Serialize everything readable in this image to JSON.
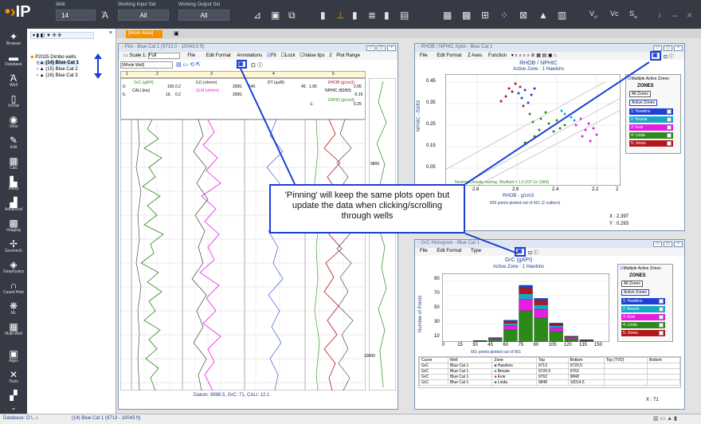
{
  "app": {
    "logo": "IP"
  },
  "toolbar": {
    "well_label": "Well",
    "well_value": "14",
    "input_set_label": "Working Input Set",
    "input_set_value": "All",
    "output_set_label": "Working Output Set",
    "output_set_value": "All",
    "right_labels": [
      "V",
      "Vc",
      "S"
    ]
  },
  "sidebar": {
    "items": [
      "Browser",
      "Database",
      "Well",
      "In/Out",
      "View",
      "Edit",
      "Calc",
      "Interp",
      "Advanced",
      "Imaging",
      "Geomech",
      "Geophysics",
      "Cased Hole",
      "ML",
      "Multi-Well",
      "Apps",
      "Tools"
    ]
  },
  "tree": {
    "root": "P2025 Dimbo wells",
    "items": [
      "(14) Blue Cat 1",
      "(15) Blue Cat 2",
      "(16) Blue Cat 3"
    ]
  },
  "workspace": {
    "tab": "[Work Area]"
  },
  "plot_window": {
    "title": "Plot - Blue Cat 1 (9713.0 - 10043.0 ft)",
    "scale_label": "Scale 1:",
    "scale_value": "Full",
    "menu": [
      "File",
      "Edit Format",
      "Annotations",
      "Fit",
      "Lock",
      "Value tips",
      "2",
      "Plot Range"
    ],
    "range": "[Whole Well]",
    "tracks": [
      "1",
      "2",
      "3",
      "4",
      "5"
    ],
    "curves": {
      "t2": [
        "GrC (gAPI)",
        "CALI (ins)"
      ],
      "t3": [
        "ILD (ohmm)",
        "SLM (ohmm)"
      ],
      "t4": [
        "DT (us/ft)"
      ],
      "t5": [
        "RHOB (g/cm3)",
        "NPHIC (ft3/ft3)",
        "DRHO (g/cm3)"
      ]
    },
    "scale_values": [
      "0.",
      "150.",
      "0.2",
      "2000.",
      "140.",
      "40.",
      "1.95",
      "2.95",
      "0.45",
      "-0.15",
      "-1.",
      "0.25",
      "6.",
      "16.",
      "0.2",
      "2000."
    ],
    "depth_marks": [
      "9800",
      "10000"
    ],
    "footer": "Datum: 9898.5,   GrC: 71,   CALI: 12.1"
  },
  "xplot_window": {
    "title": "RHOB / NPHIC Xplot - Blue Cat 1",
    "menu": [
      "File",
      "Edit Format",
      "Z Axes",
      "Function"
    ],
    "chart_title": "RHOB / NPHIC",
    "subtitle": "Active Zone : 1  Hawkins",
    "xlabel": "RHOB - g/cm3",
    "ylabel": "NPHIC - ft3/ft3",
    "yticks": [
      "0.45",
      "0.35",
      "0.25",
      "0.15",
      "0.05"
    ],
    "xticks": [
      "2.8",
      "2.6",
      "2.4",
      "2.2",
      "2"
    ],
    "overlay": "Neutron/Density overlay, Rhofluid = 1.0 (CP-1e 1989)",
    "points_text": "659 points plotted out of 661 (2 outliers)",
    "readout_x": "X : 2.397",
    "readout_y": "Y : 0.293"
  },
  "zones": {
    "multiple": "Multiple Active Zones",
    "heading": "ZONES",
    "all": "All Zones",
    "active": "Active Zones",
    "list": [
      "1: Hawkins",
      "2: Bessie",
      "3: Evie",
      "4: Linda",
      "5: Jones"
    ],
    "colors": [
      "#1f3fd6",
      "#19a7c7",
      "#e61ee0",
      "#2c8a1a",
      "#b5161d"
    ]
  },
  "histo_window": {
    "title": "GrC Histogram - Blue Cat 1",
    "menu": [
      "File",
      "Edit Format",
      "Type"
    ],
    "chart_title": "GrC (gAPI)",
    "subtitle": "Active Zone : 1  Hawkins",
    "ylabel": "Number of Points",
    "yticks": [
      "90",
      "80",
      "70",
      "60",
      "50",
      "40",
      "30",
      "20",
      "10",
      "0"
    ],
    "xticks": [
      "0",
      "15",
      "30",
      "45",
      "60",
      "75",
      "90",
      "105",
      "120",
      "135",
      "150"
    ],
    "points_text": "661 points plotted out of 661",
    "readout_x": "X : 71",
    "table_headers": [
      "Curve",
      "Well",
      "Zone",
      "Top",
      "Bottom",
      "Top (TVD)",
      "Bottom"
    ],
    "table_rows": [
      [
        "GrC",
        "Blue Cat 1",
        "Hawkins",
        "9713",
        "9720.5"
      ],
      [
        "GrC",
        "Blue Cat 1",
        "Bessie",
        "9720.5",
        "9762"
      ],
      [
        "GrC",
        "Blue Cat 1",
        "Evie",
        "9762",
        "9848"
      ],
      [
        "GrC",
        "Blue Cat 1",
        "Linda",
        "9848",
        "10014.5"
      ]
    ]
  },
  "callout": {
    "text": "'Pinning' will keep the same plots open but update the data when clicking/scrolling through wells"
  },
  "status": {
    "db": "Database: D:\\...\\",
    "well": "(14) Blue Cat 1 (9713 - 10043 ft)"
  },
  "chart_data": [
    {
      "type": "bar",
      "title": "GrC (gAPI)",
      "ylabel": "Number of Points",
      "categories": [
        "0",
        "15",
        "30",
        "45",
        "60",
        "75",
        "90",
        "105",
        "120",
        "135",
        "150"
      ],
      "ylim": [
        0,
        90
      ],
      "series": [
        {
          "name": "Hawkins",
          "values": [
            0,
            0,
            2,
            6,
            30,
            78,
            60,
            26,
            8,
            3,
            0
          ]
        }
      ]
    }
  ]
}
